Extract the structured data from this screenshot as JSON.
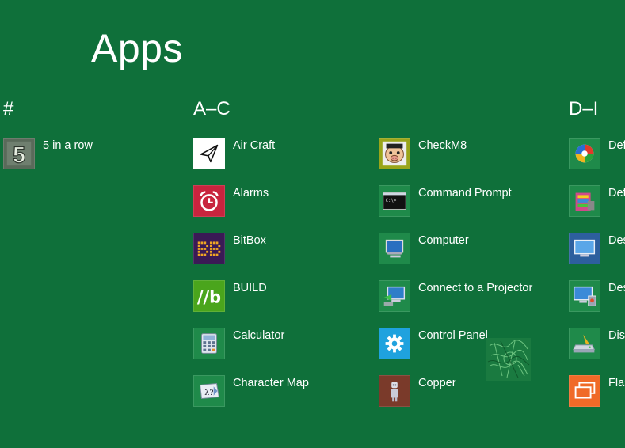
{
  "page": {
    "title": "Apps"
  },
  "groups": [
    {
      "header": "#"
    },
    {
      "header": "A–C"
    },
    {
      "header": "D–I"
    }
  ],
  "apps": {
    "five_in_a_row": {
      "label": "5 in a row",
      "icon": "five-icon"
    },
    "air_craft": {
      "label": "Air Craft",
      "icon": "paper-plane-icon"
    },
    "alarms": {
      "label": "Alarms",
      "icon": "alarm-clock-icon"
    },
    "bitbox": {
      "label": "BitBox",
      "icon": "bitbox-icon"
    },
    "build": {
      "label": "BUILD",
      "icon": "build-b-icon"
    },
    "calculator": {
      "label": "Calculator",
      "icon": "calculator-icon"
    },
    "character_map": {
      "label": "Character Map",
      "icon": "character-map-icon"
    },
    "checkm8": {
      "label": "CheckM8",
      "icon": "pig-face-icon"
    },
    "command_prompt": {
      "label": "Command Prompt",
      "icon": "command-prompt-icon"
    },
    "computer": {
      "label": "Computer",
      "icon": "computer-icon"
    },
    "connect_projector": {
      "label": "Connect to a Projector",
      "icon": "projector-icon"
    },
    "control_panel": {
      "label": "Control Panel",
      "icon": "gear-icon"
    },
    "copper": {
      "label": "Copper",
      "icon": "copper-robot-icon"
    },
    "default_programs": {
      "label": "Def",
      "icon": "default-programs-icon"
    },
    "default_options": {
      "label": "Def Opt",
      "icon": "default-options-icon"
    },
    "desktop": {
      "label": "Des",
      "icon": "desktop-icon"
    },
    "desktop_gadget": {
      "label": "Des Gal",
      "icon": "desktop-gadget-icon"
    },
    "disk": {
      "label": "Dis",
      "icon": "disk-cleanup-icon"
    },
    "flash": {
      "label": "Flas",
      "icon": "flash-cards-icon"
    }
  },
  "colors": {
    "background": "#0f703a",
    "tile_green": "#1f8a4a",
    "alarms_red": "#c8243e",
    "bitbox_purple": "#3a1a55",
    "build_green": "#4aa51c",
    "control_panel_blue": "#1fa2de",
    "copper_brown": "#7a3a2a",
    "flash_orange": "#f06a28",
    "desktop_blue": "#2d5f9e"
  }
}
